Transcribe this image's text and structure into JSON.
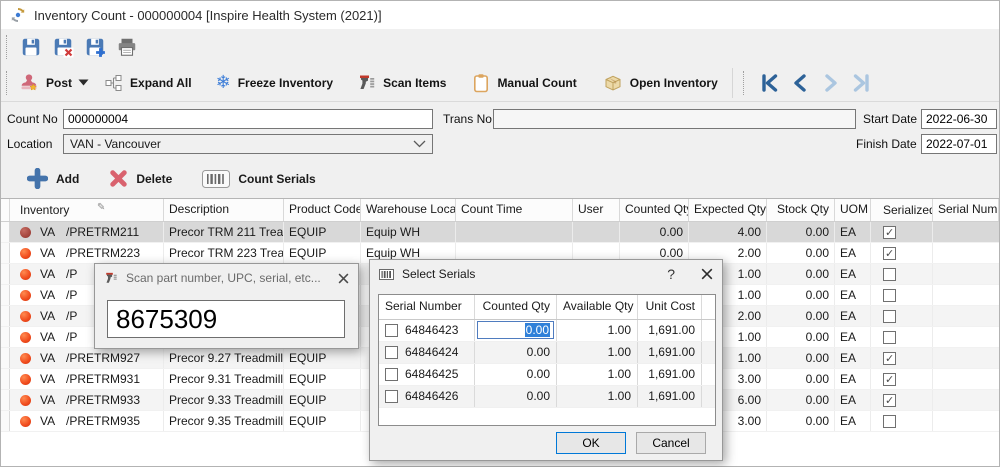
{
  "window": {
    "title": "Inventory Count - 000000004 [Inspire Health System (2021)]"
  },
  "toolbar": {
    "post": "Post",
    "expand_all": "Expand All",
    "freeze_inventory": "Freeze Inventory",
    "scan_items": "Scan Items",
    "manual_count": "Manual Count",
    "open_inventory": "Open Inventory"
  },
  "form": {
    "count_no_label": "Count No",
    "count_no": "000000004",
    "trans_no_label": "Trans No",
    "trans_no": "",
    "start_date_label": "Start Date",
    "start_date": "2022-06-30",
    "location_label": "Location",
    "location": "VAN - Vancouver",
    "finish_date_label": "Finish Date",
    "finish_date": "2022-07-01"
  },
  "actions": {
    "add": "Add",
    "delete": "Delete",
    "count_serials": "Count Serials"
  },
  "grid": {
    "columns": [
      "Inventory",
      "Description",
      "Product Code",
      "Warehouse Location",
      "Count Time",
      "User",
      "Counted Qty",
      "Expected Qty",
      "Stock Qty",
      "UOM",
      "Serialized",
      "Serial Number"
    ],
    "rows": [
      {
        "selected": true,
        "branch": "VA",
        "item": "/PRETRM211",
        "description": "Precor TRM 211 Trea...",
        "product_code": "EQUIP",
        "warehouse_location": "Equip WH",
        "count_time": "",
        "user": "",
        "counted_qty": "0.00",
        "expected_qty": "4.00",
        "stock_qty": "0.00",
        "uom": "EA",
        "serialized": true,
        "serial_number": ""
      },
      {
        "branch": "VA",
        "item": "/PRETRM223",
        "description": "Precor TRM 223 Trea...",
        "product_code": "EQUIP",
        "warehouse_location": "Equip WH",
        "count_time": "",
        "user": "",
        "counted_qty": "0.00",
        "expected_qty": "2.00",
        "stock_qty": "0.00",
        "uom": "EA",
        "serialized": true,
        "serial_number": ""
      },
      {
        "branch": "VA",
        "item": "/P",
        "description": "",
        "product_code": "",
        "warehouse_location": "",
        "count_time": "",
        "user": "",
        "counted_qty": "",
        "expected_qty": "1.00",
        "stock_qty": "0.00",
        "uom": "EA",
        "serialized": false,
        "serial_number": ""
      },
      {
        "branch": "VA",
        "item": "/P",
        "description": "",
        "product_code": "",
        "warehouse_location": "",
        "count_time": "",
        "user": "",
        "counted_qty": "",
        "expected_qty": "1.00",
        "stock_qty": "0.00",
        "uom": "EA",
        "serialized": false,
        "serial_number": ""
      },
      {
        "branch": "VA",
        "item": "/P",
        "description": "",
        "product_code": "",
        "warehouse_location": "",
        "count_time": "",
        "user": "",
        "counted_qty": "",
        "expected_qty": "2.00",
        "stock_qty": "0.00",
        "uom": "EA",
        "serialized": false,
        "serial_number": ""
      },
      {
        "branch": "VA",
        "item": "/P",
        "description": "",
        "product_code": "",
        "warehouse_location": "",
        "count_time": "",
        "user": "",
        "counted_qty": "",
        "expected_qty": "1.00",
        "stock_qty": "0.00",
        "uom": "EA",
        "serialized": false,
        "serial_number": ""
      },
      {
        "branch": "VA",
        "item": "/PRETRM927",
        "description": "Precor 9.27 Treadmill",
        "product_code": "EQUIP",
        "warehouse_location": "",
        "count_time": "",
        "user": "",
        "counted_qty": "",
        "expected_qty": "1.00",
        "stock_qty": "0.00",
        "uom": "EA",
        "serialized": true,
        "serial_number": ""
      },
      {
        "branch": "VA",
        "item": "/PRETRM931",
        "description": "Precor 9.31 Treadmill",
        "product_code": "EQUIP",
        "warehouse_location": "",
        "count_time": "",
        "user": "",
        "counted_qty": "",
        "expected_qty": "3.00",
        "stock_qty": "0.00",
        "uom": "EA",
        "serialized": true,
        "serial_number": ""
      },
      {
        "branch": "VA",
        "item": "/PRETRM933",
        "description": "Precor 9.33 Treadmill",
        "product_code": "EQUIP",
        "warehouse_location": "",
        "count_time": "",
        "user": "",
        "counted_qty": "",
        "expected_qty": "6.00",
        "stock_qty": "0.00",
        "uom": "EA",
        "serialized": true,
        "serial_number": ""
      },
      {
        "branch": "VA",
        "item": "/PRETRM935",
        "description": "Precor 9.35 Treadmill",
        "product_code": "EQUIP",
        "warehouse_location": "",
        "count_time": "",
        "user": "",
        "counted_qty": "",
        "expected_qty": "3.00",
        "stock_qty": "0.00",
        "uom": "EA",
        "serialized": false,
        "serial_number": ""
      }
    ]
  },
  "scan_dialog": {
    "title": "Scan part number, UPC, serial, etc...",
    "value": "8675309"
  },
  "serials_dialog": {
    "title": "Select Serials",
    "help_label": "?",
    "columns": [
      "Serial Number",
      "Counted Qty",
      "Available Qty",
      "Unit Cost"
    ],
    "rows": [
      {
        "checked": false,
        "editing": true,
        "serial_number": "64846423",
        "counted_qty": "0.00",
        "available_qty": "1.00",
        "unit_cost": "1,691.00"
      },
      {
        "checked": false,
        "serial_number": "64846424",
        "counted_qty": "0.00",
        "available_qty": "1.00",
        "unit_cost": "1,691.00"
      },
      {
        "checked": false,
        "serial_number": "64846425",
        "counted_qty": "0.00",
        "available_qty": "1.00",
        "unit_cost": "1,691.00"
      },
      {
        "checked": false,
        "serial_number": "64846426",
        "counted_qty": "0.00",
        "available_qty": "1.00",
        "unit_cost": "1,691.00"
      }
    ],
    "ok": "OK",
    "cancel": "Cancel"
  },
  "colors": {
    "accent": "#0078d7",
    "status_orange": "#f04a1c",
    "nav_enabled": "#2d6298",
    "nav_disabled": "#abc6e0"
  }
}
